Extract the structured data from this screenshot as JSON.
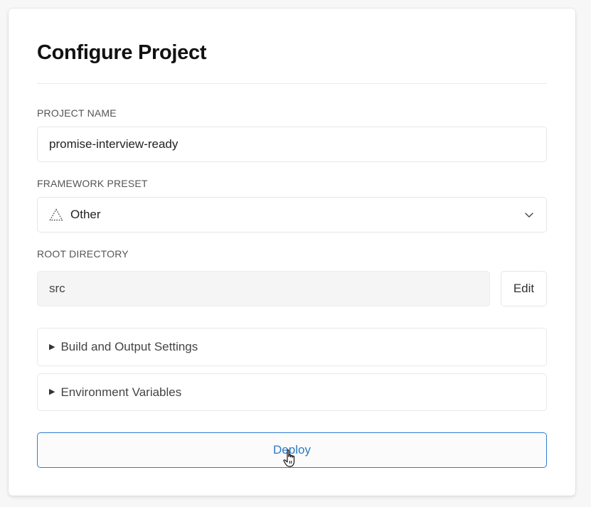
{
  "title": "Configure Project",
  "project_name": {
    "label": "PROJECT NAME",
    "value": "promise-interview-ready"
  },
  "framework_preset": {
    "label": "FRAMEWORK PRESET",
    "value": "Other",
    "icon": "dotted-triangle-icon"
  },
  "root_directory": {
    "label": "ROOT DIRECTORY",
    "value": "src",
    "edit_label": "Edit"
  },
  "sections": [
    {
      "label": "Build and Output Settings",
      "expanded": false
    },
    {
      "label": "Environment Variables",
      "expanded": false
    }
  ],
  "deploy_label": "Deploy",
  "colors": {
    "accent": "#2d78c8",
    "card_bg": "#ffffff",
    "page_bg": "#f7f7f7"
  }
}
